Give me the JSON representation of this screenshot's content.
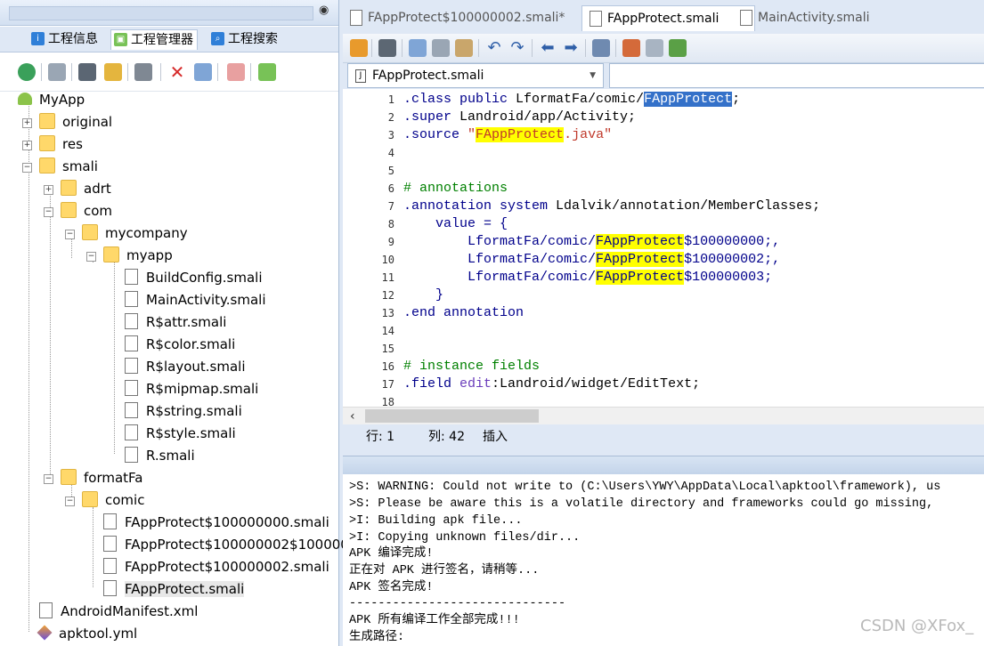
{
  "left_panel": {
    "tabs": [
      {
        "label": "工程信息",
        "icon": "info-icon",
        "color": "#2f7fd8"
      },
      {
        "label": "工程管理器",
        "icon": "android-icon",
        "color": "#78c257"
      },
      {
        "label": "工程搜索",
        "icon": "search-icon",
        "color": "#2f7fd8"
      }
    ],
    "toolbar_icons": [
      "refresh-icon",
      "image-icon",
      "window-icon",
      "find-icon",
      "book-icon",
      "delete-icon",
      "rename-icon",
      "pdf-icon",
      "android-icon"
    ]
  },
  "tree": {
    "root": "MyApp",
    "original": "original",
    "res": "res",
    "smali": "smali",
    "adrt": "adrt",
    "com": "com",
    "mycompany": "mycompany",
    "myapp": "myapp",
    "myapp_files": [
      "BuildConfig.smali",
      "MainActivity.smali",
      "R$attr.smali",
      "R$color.smali",
      "R$layout.smali",
      "R$mipmap.smali",
      "R$string.smali",
      "R$style.smali",
      "R.smali"
    ],
    "formatFa": "formatFa",
    "comic": "comic",
    "comic_files": [
      "FAppProtect$100000000.smali",
      "FAppProtect$100000002$100000",
      "FAppProtect$100000002.smali",
      "FAppProtect.smali"
    ],
    "manifest": "AndroidManifest.xml",
    "apktool": "apktool.yml"
  },
  "editor": {
    "tabs": [
      "FAppProtect$100000002.smali*",
      "FAppProtect.smali",
      "MainActivity.smali"
    ],
    "active_tab": 1,
    "file_select": "FAppProtect.smali",
    "toolbar_icons": [
      "lock-icon",
      "save-icon",
      "copy-icon",
      "cut-icon",
      "paste-icon",
      "undo-icon",
      "redo-icon",
      "back-icon",
      "forward-icon",
      "format-icon",
      "java-icon",
      "list-icon",
      "run-icon"
    ],
    "line_numbers": [
      "1",
      "2",
      "3",
      "4",
      "5",
      "6",
      "7",
      "8",
      "9",
      "10",
      "11",
      "12",
      "13",
      "14",
      "15",
      "16",
      "17",
      "18"
    ],
    "code": {
      "l1a": ".class",
      "l1b": " public",
      "l1c": " LformatFa/comic/",
      "l1sel": "FAppProtect",
      "l1d": ";",
      "l2a": ".super",
      "l2b": " Landroid/app/Activity;",
      "l3a": ".source",
      "l3b": " \"",
      "l3hl": "FAppProtect",
      "l3c": ".java\"",
      "l6": "# annotations",
      "l7a": ".annotation",
      "l7b": " system",
      "l7c": " Ldalvik/annotation/MemberClasses;",
      "l8": "    value = {",
      "l9a": "        LformatFa/comic/",
      "l9hl": "FAppProtect",
      "l9b": "$100000000;,",
      "l10a": "        LformatFa/comic/",
      "l10hl": "FAppProtect",
      "l10b": "$100000002;,",
      "l11a": "        LformatFa/comic/",
      "l11hl": "FAppProtect",
      "l11b": "$100000003;",
      "l12": "    }",
      "l13a": ".end",
      "l13b": " annotation",
      "l16": "# instance fields",
      "l17a": ".field",
      "l17b": " edit",
      "l17c": ":Landroid/widget/EditText;"
    },
    "status": {
      "row": "行: 1",
      "col": "列: 42",
      "mode": "插入"
    }
  },
  "output": [
    ">S: WARNING: Could not write to (C:\\Users\\YWY\\AppData\\Local\\apktool\\framework), us",
    ">S: Please be aware this is a volatile directory and frameworks could go missing,",
    ">I: Building apk file...",
    ">I: Copying unknown files/dir...",
    "APK 编译完成!",
    "正在对 APK 进行签名，请稍等...",
    "APK 签名完成!",
    "------------------------------",
    "APK 所有编译工作全部完成!!!",
    "生成路径:"
  ],
  "watermark": "CSDN @XFox_"
}
